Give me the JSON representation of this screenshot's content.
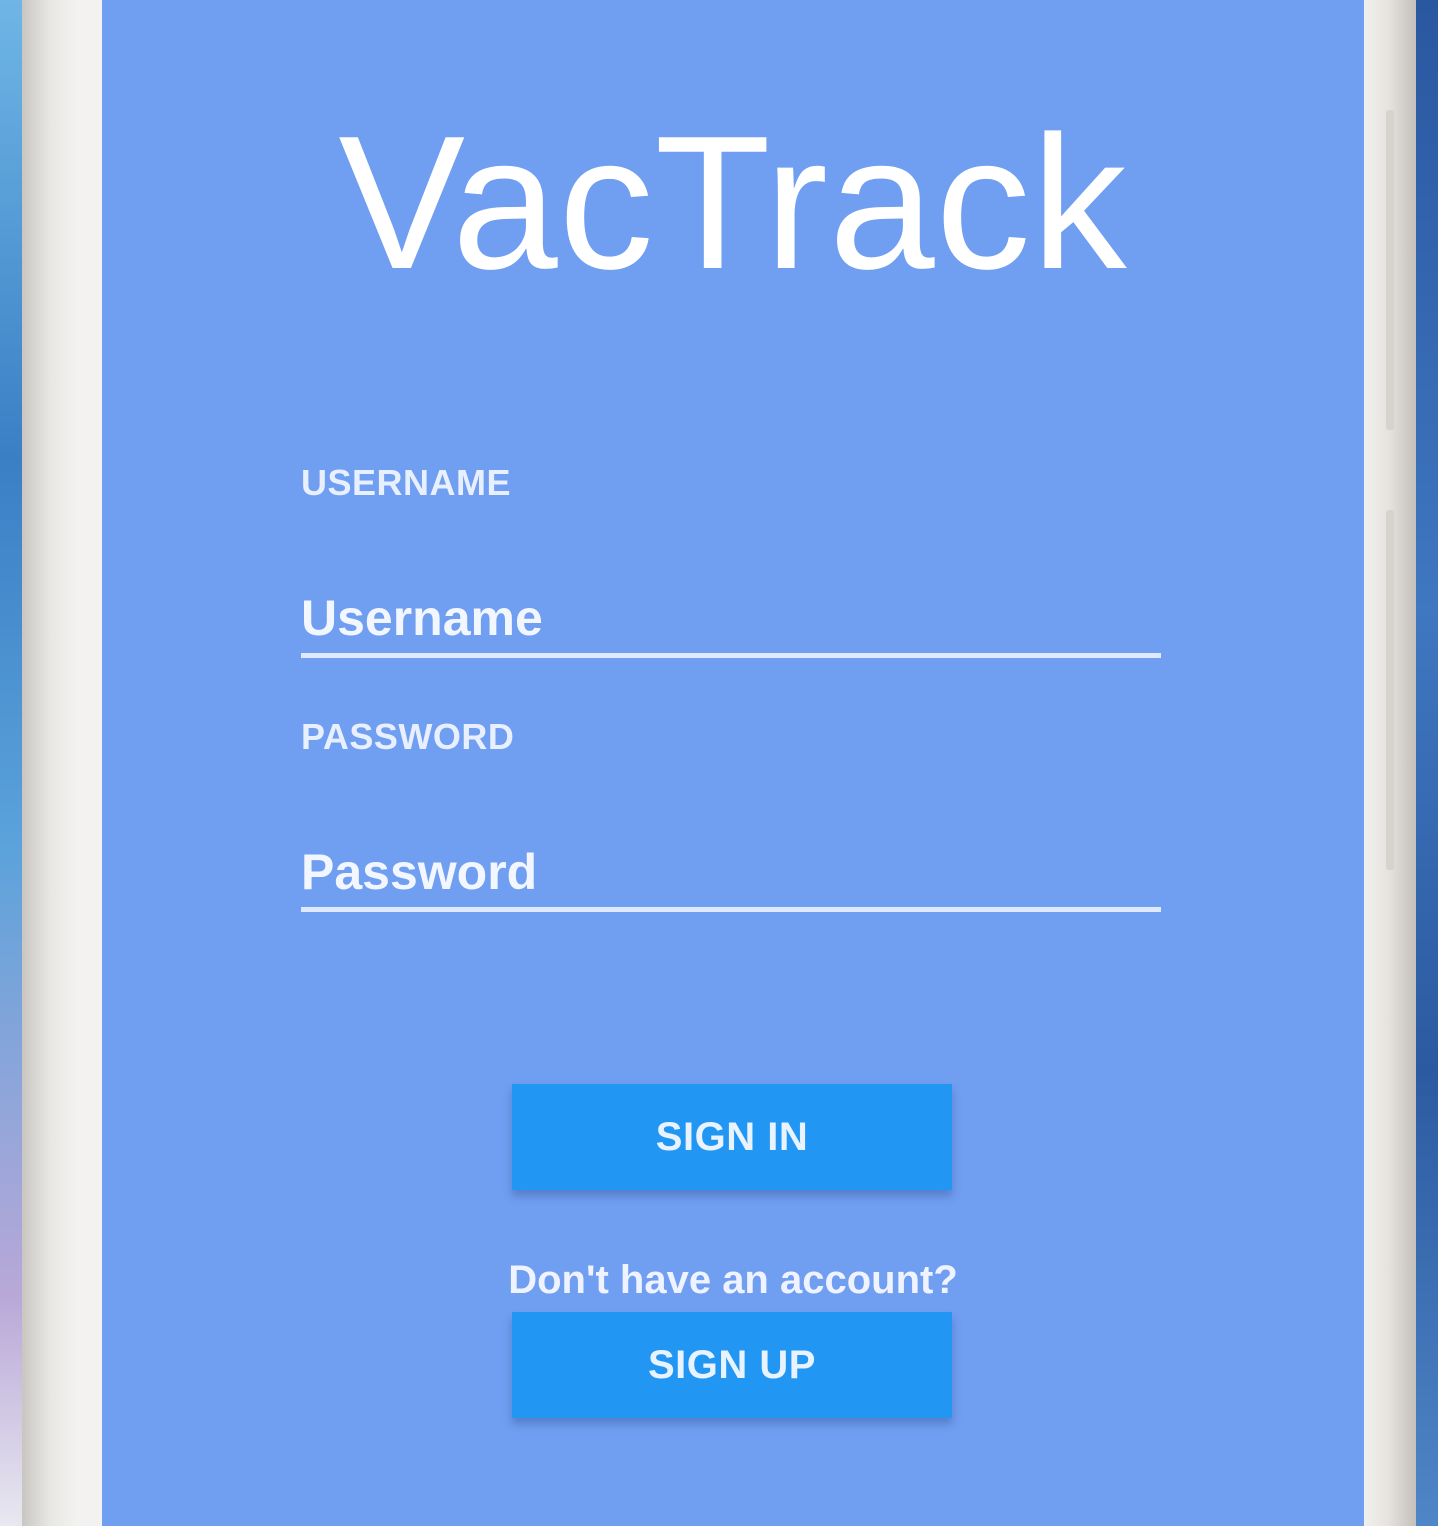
{
  "app": {
    "title": "VacTrack"
  },
  "form": {
    "username": {
      "label": "USERNAME",
      "placeholder": "Username",
      "value": ""
    },
    "password": {
      "label": "PASSWORD",
      "placeholder": "Password",
      "value": ""
    }
  },
  "actions": {
    "sign_in_label": "SIGN IN",
    "no_account_text": "Don't have an account?",
    "sign_up_label": "SIGN UP"
  },
  "colors": {
    "screen_background": "#709ef0",
    "button": "#2196f3",
    "text": "#ffffff"
  }
}
